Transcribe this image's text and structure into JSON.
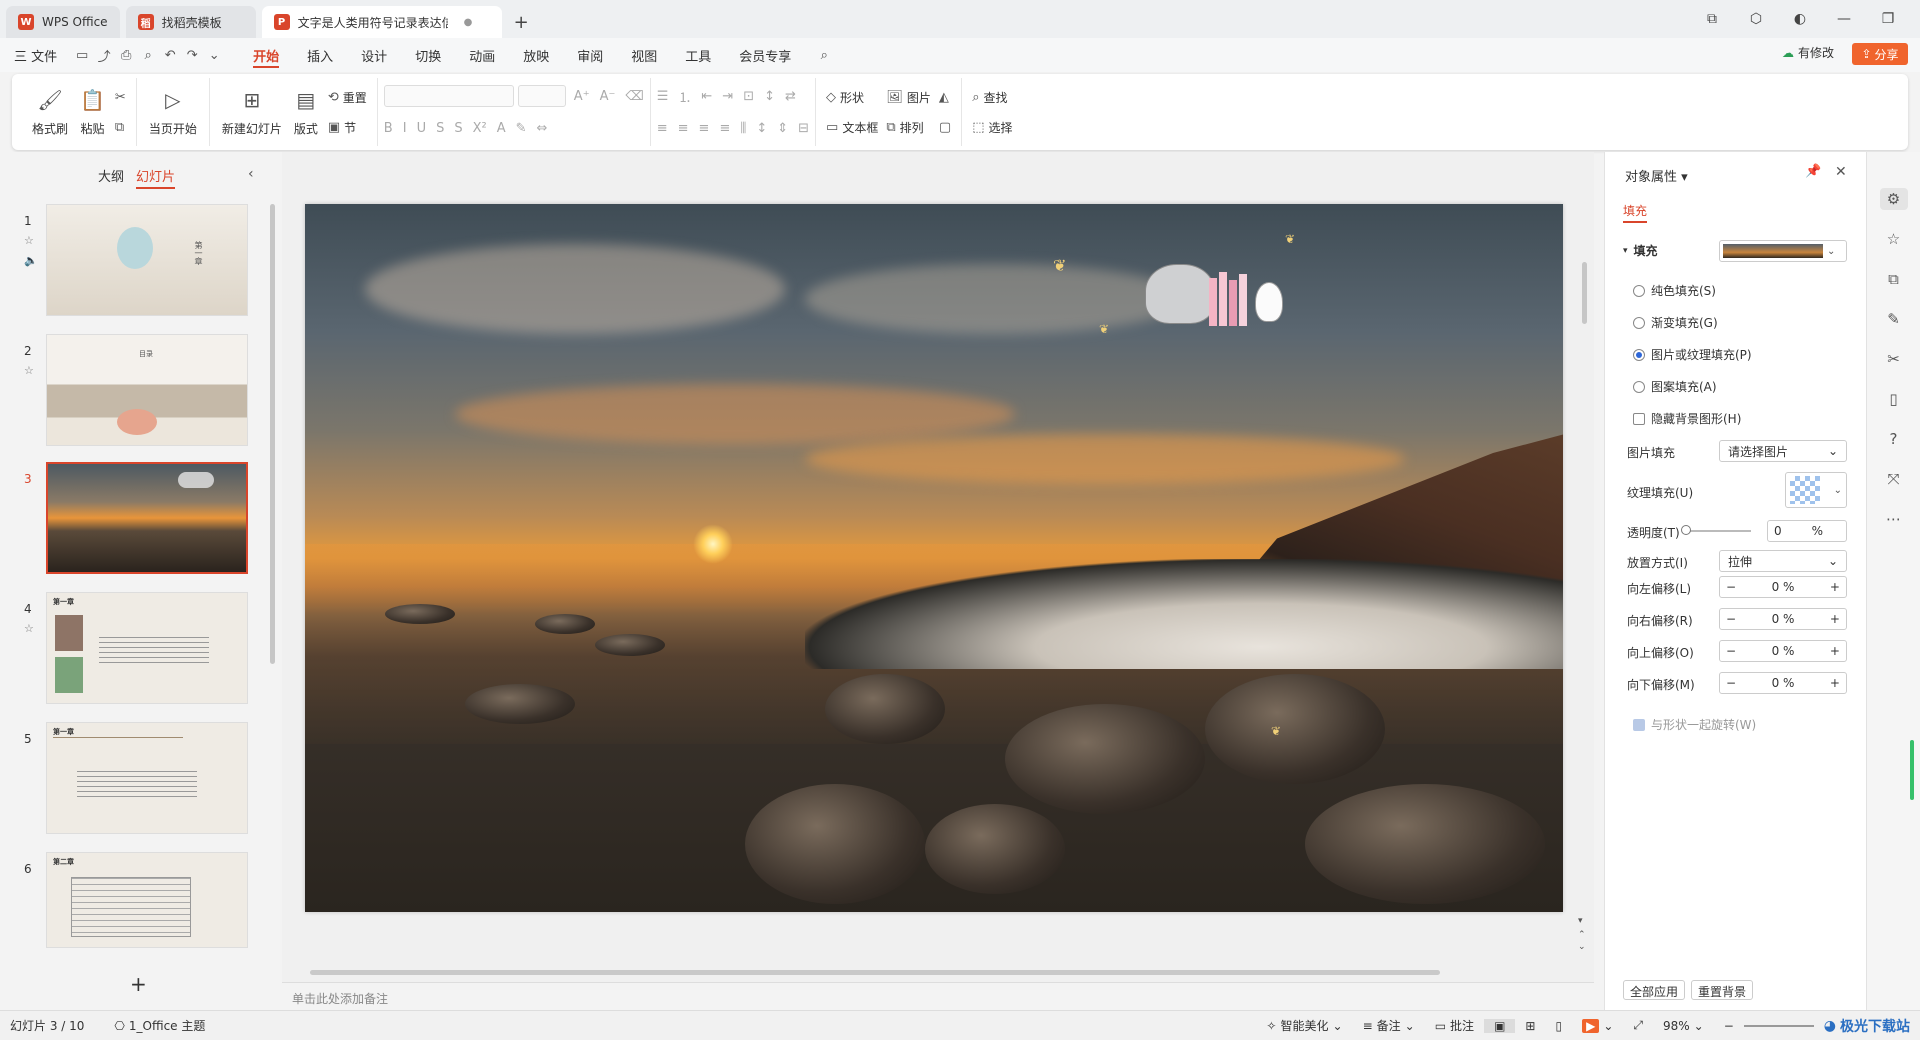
{
  "titlebar": {
    "tabs": [
      {
        "label": "WPS Office",
        "icon": "wps-logo-icon",
        "color": "#d9452b"
      },
      {
        "label": "找稻壳模板",
        "icon": "docer-icon",
        "color": "#d9452b"
      },
      {
        "label": "文字是人类用符号记录表达信息以",
        "icon": "ppt-icon",
        "color": "#d9452b"
      }
    ],
    "new_tab": "+"
  },
  "menubar": {
    "file": "三 文件",
    "items": [
      "开始",
      "插入",
      "设计",
      "切换",
      "动画",
      "放映",
      "审阅",
      "视图",
      "工具",
      "会员专享"
    ],
    "active": "开始",
    "edit_status": "有修改",
    "share": "分享"
  },
  "ribbon": {
    "format_painter": "格式刷",
    "paste": "粘贴",
    "from_current": "当页开始",
    "new_slide": "新建幻灯片",
    "layout": "版式",
    "reset": "重置",
    "section": "节",
    "shape": "形状",
    "picture": "图片",
    "textbox": "文本框",
    "arrange": "排列",
    "find": "查找",
    "select": "选择"
  },
  "leftpanel": {
    "tabs": [
      "大纲",
      "幻灯片"
    ],
    "active_tab": "幻灯片",
    "slides": [
      {
        "num": "1",
        "text": "第一章"
      },
      {
        "num": "2",
        "text": "目录"
      },
      {
        "num": "3",
        "text": ""
      },
      {
        "num": "4",
        "text": "第一章"
      },
      {
        "num": "5",
        "text": "第一章"
      },
      {
        "num": "6",
        "text": "第二章"
      }
    ],
    "active_slide": 3,
    "add": "+"
  },
  "notes": {
    "placeholder": "单击此处添加备注"
  },
  "rightpanel": {
    "title": "对象属性",
    "subtab": "填充",
    "section": "填充",
    "options": [
      {
        "label": "纯色填充(S)",
        "checked": false
      },
      {
        "label": "渐变填充(G)",
        "checked": false
      },
      {
        "label": "图片或纹理填充(P)",
        "checked": true
      },
      {
        "label": "图案填充(A)",
        "checked": false
      }
    ],
    "hide_bg": "隐藏背景图形(H)",
    "picture_fill_label": "图片填充",
    "picture_fill_value": "请选择图片",
    "texture_fill_label": "纹理填充(U)",
    "transparency_label": "透明度(T)",
    "transparency_value": "0",
    "transparency_unit": "%",
    "placement_label": "放置方式(I)",
    "placement_value": "拉伸",
    "offsets": [
      {
        "label": "向左偏移(L)",
        "value": "0 %"
      },
      {
        "label": "向右偏移(R)",
        "value": "0 %"
      },
      {
        "label": "向上偏移(O)",
        "value": "0 %"
      },
      {
        "label": "向下偏移(M)",
        "value": "0 %"
      }
    ],
    "rotate_with_shape": "与形状一起旋转(W)",
    "apply_all": "全部应用",
    "reset_bg": "重置背景"
  },
  "statusbar": {
    "slide_info": "幻灯片 3 / 10",
    "theme": "1_Office 主题",
    "beautify": "智能美化",
    "notes": "备注",
    "comments": "批注",
    "zoom": "98%"
  },
  "watermark": {
    "text": "极光下载站"
  }
}
